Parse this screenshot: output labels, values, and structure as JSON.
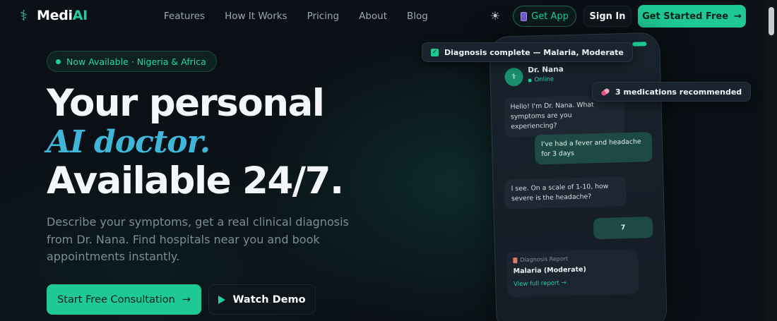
{
  "nav": {
    "brand_prefix": "Medi",
    "brand_suffix": "AI",
    "links": [
      "Features",
      "How It Works",
      "Pricing",
      "About",
      "Blog"
    ],
    "get_app_label": "Get App",
    "sign_in_label": "Sign In",
    "get_started_label": "Get Started Free"
  },
  "hero": {
    "badge": "Now Available · Nigeria & Africa",
    "headline_line1": "Your personal",
    "headline_line2": "AI doctor.",
    "headline_line3": "Available 24/7.",
    "subtext": "Describe your symptoms, get a real clinical diagnosis from Dr. Nana. Find hospitals near you and book appointments instantly.",
    "primary_cta": "Start Free Consultation",
    "secondary_cta": "Watch Demo"
  },
  "mockup": {
    "chip_diagnosis": "Diagnosis complete — Malaria, Moderate",
    "chip_medications": "3 medications recommended",
    "doctor_name": "Dr. Nana",
    "doctor_status": "Online",
    "messages": [
      {
        "from": "bot",
        "text": "Hello! I'm Dr. Nana. What symptoms are you experiencing?"
      },
      {
        "from": "user",
        "text": "I've had a fever and headache for 3 days"
      },
      {
        "from": "bot",
        "text": "I see. On a scale of 1-10, how severe is the headache?"
      },
      {
        "from": "user",
        "text": "7"
      }
    ],
    "report_label": "Diagnosis Report",
    "report_title": "Malaria (Moderate)",
    "report_link": "View full report →"
  },
  "colors": {
    "accent": "#1fc993",
    "accent_text": "#1fd1a0",
    "headline_italic": "#3fb5d8",
    "background": "#0a1016"
  }
}
